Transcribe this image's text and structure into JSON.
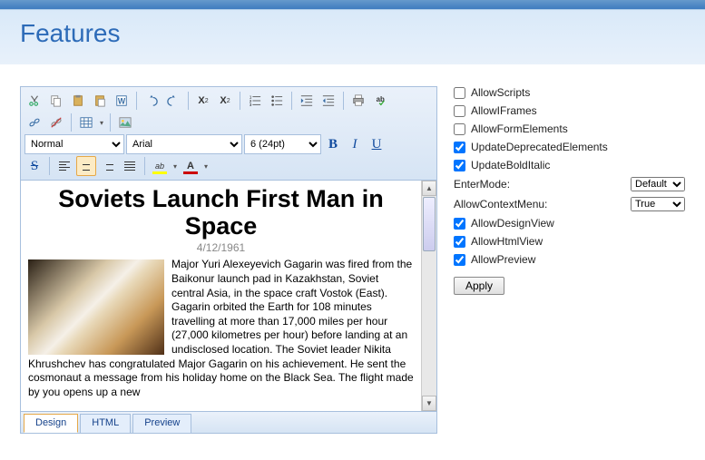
{
  "header": {
    "title": "Features"
  },
  "toolbar": {
    "block_format": "Normal",
    "font_family": "Arial",
    "font_size": "6 (24pt)",
    "bold": "B",
    "italic": "I",
    "underline": "U",
    "strike": "S",
    "fg_letter": "A",
    "bg_letter": "ab",
    "sup": "X",
    "sub": "X"
  },
  "content": {
    "headline": "Soviets Launch First Man in Space",
    "date": "4/12/1961",
    "body": "Major Yuri Alexeyevich Gagarin was fired from the Baikonur launch pad in Kazakhstan, Soviet central Asia, in the space craft Vostok (East). Gagarin orbited the Earth for 108 minutes travelling at more than 17,000 miles per hour (27,000 kilometres per hour) before landing at an undisclosed location. The Soviet leader Nikita Khrushchev has congratulated Major Gagarin on his achievement. He sent the cosmonaut a message from his holiday home on the Black Sea. The flight made by you opens up a new"
  },
  "tabs": {
    "design": "Design",
    "html": "HTML",
    "preview": "Preview"
  },
  "options": {
    "allowScripts": {
      "label": "AllowScripts",
      "checked": false
    },
    "allowIFrames": {
      "label": "AllowIFrames",
      "checked": false
    },
    "allowFormElements": {
      "label": "AllowFormElements",
      "checked": false
    },
    "updateDeprecated": {
      "label": "UpdateDeprecatedElements",
      "checked": true
    },
    "updateBoldItalic": {
      "label": "UpdateBoldItalic",
      "checked": true
    },
    "enterMode": {
      "label": "EnterMode:",
      "value": "Default"
    },
    "allowContextMenu": {
      "label": "AllowContextMenu:",
      "value": "True"
    },
    "allowDesignView": {
      "label": "AllowDesignView",
      "checked": true
    },
    "allowHtmlView": {
      "label": "AllowHtmlView",
      "checked": true
    },
    "allowPreview": {
      "label": "AllowPreview",
      "checked": true
    },
    "apply": "Apply"
  }
}
